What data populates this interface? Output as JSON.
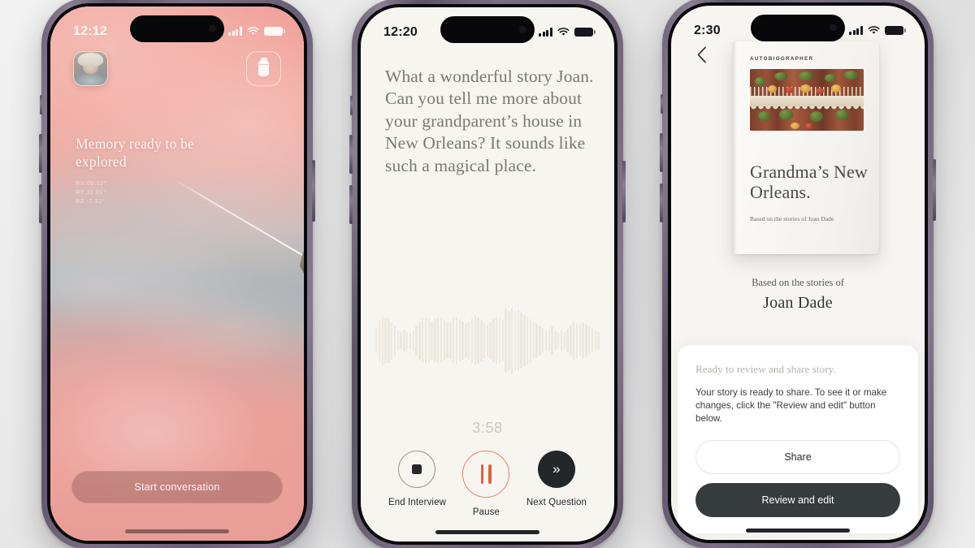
{
  "phone1": {
    "status": {
      "time": "12:12",
      "signal_icon": "cellular-bars-icon",
      "wifi_icon": "wifi-icon",
      "battery_icon": "battery-icon"
    },
    "avatar_alt": "Joan Dade portrait",
    "jar_button_icon": "memory-jar-icon",
    "headline": "Memory ready to be explored",
    "coords": [
      "RX 00.12°",
      "RY 11.01°",
      "RZ -7.32°"
    ],
    "artifact_name": "memory-stone",
    "cta_label": "Start conversation"
  },
  "phone2": {
    "status": {
      "time": "12:20",
      "signal_icon": "cellular-bars-icon",
      "wifi_icon": "wifi-icon",
      "battery_icon": "battery-icon"
    },
    "question": "What a wonderful story Joan. Can you tell me more about your grandparent’s house in New Orleans? It sounds like such a magical place.",
    "elapsed": "3:58",
    "waveform": [
      38,
      62,
      74,
      70,
      66,
      58,
      44,
      30,
      26,
      34,
      26,
      22,
      30,
      44,
      58,
      66,
      70,
      66,
      58,
      64,
      70,
      66,
      60,
      52,
      56,
      66,
      72,
      64,
      58,
      50,
      58,
      68,
      74,
      70,
      62,
      54,
      48,
      56,
      64,
      72,
      70,
      62,
      96,
      90,
      100,
      88,
      92,
      84,
      78,
      72,
      64,
      56,
      50,
      44,
      38,
      30,
      34,
      42,
      28,
      22,
      30,
      26,
      36,
      48,
      58,
      52,
      46,
      54,
      50,
      44,
      38,
      30,
      26
    ],
    "controls": [
      {
        "label": "End Interview",
        "icon": "stop-icon",
        "accent": "#26282b"
      },
      {
        "label": "Pause",
        "icon": "pause-icon",
        "accent": "#e2603b"
      },
      {
        "label": "Next Question",
        "icon": "double-chevron-right-icon",
        "accent": "#232729"
      }
    ]
  },
  "phone3": {
    "status": {
      "time": "2:30",
      "signal_icon": "cellular-bars-icon",
      "wifi_icon": "wifi-icon",
      "battery_icon": "battery-icon"
    },
    "back_icon": "chevron-left-icon",
    "book": {
      "brand": "AUTOBIOGRAPHER",
      "cover_photo_alt": "New Orleans French Quarter balcony with flowers",
      "title": "Grandma’s New Orleans.",
      "subtitle": "Based on the stories of Joan Dade"
    },
    "byline": "Based on the stories of",
    "author": "Joan Dade",
    "card": {
      "heading": "Ready to review and share story.",
      "body": "Your story is ready to share. To see it or make changes, click the \"Review and edit\" button below.",
      "share_label": "Share",
      "review_label": "Review and edit"
    }
  },
  "theme": {
    "accent_orange": "#e2603b",
    "dark": "#363b3d",
    "cream": "#f7f5f0",
    "sky_pink": "#ef9e96",
    "frame_purple": "#6d6076"
  }
}
